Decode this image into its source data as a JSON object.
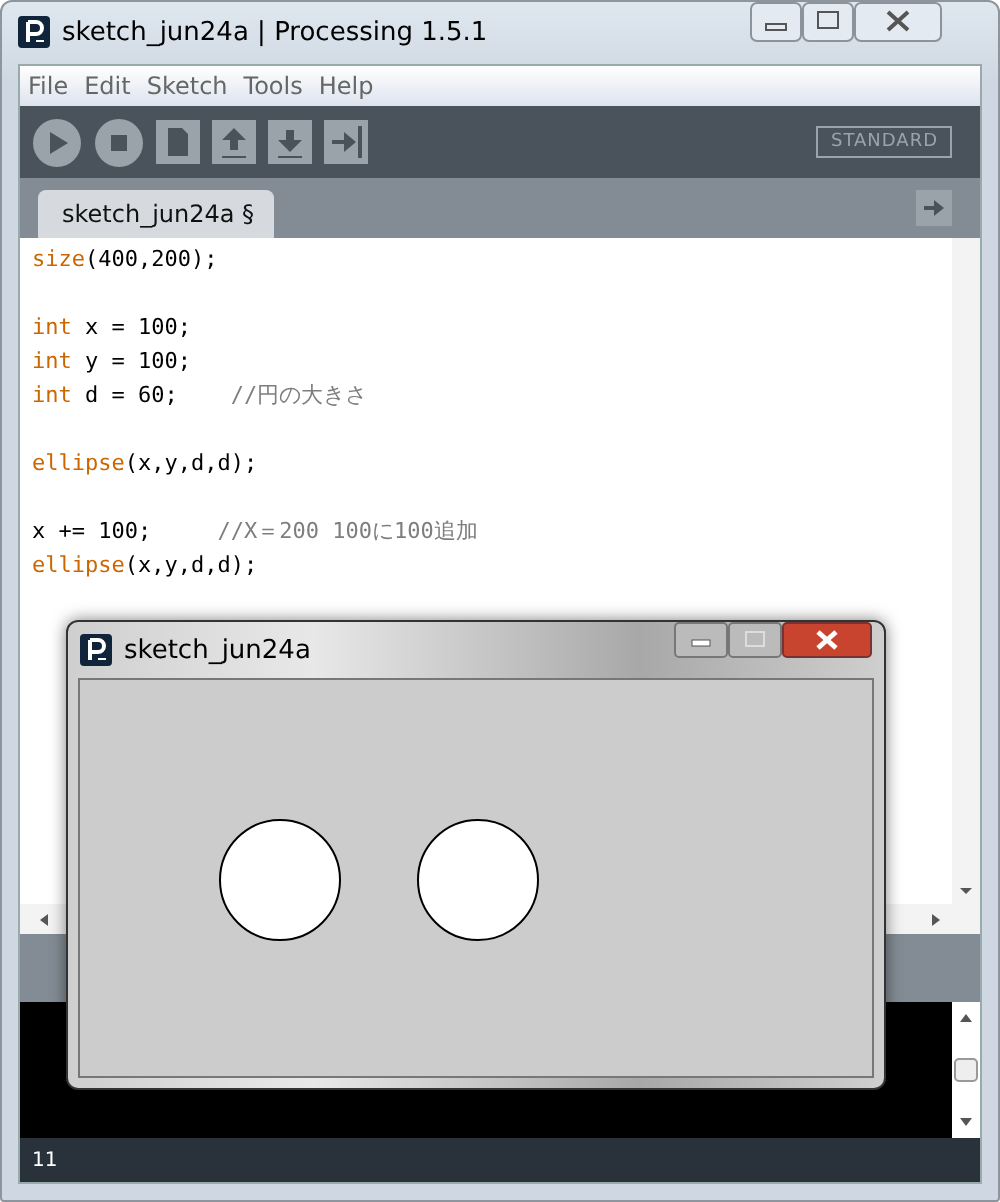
{
  "window": {
    "title": "sketch_jun24a | Processing 1.5.1"
  },
  "menu": [
    "File",
    "Edit",
    "Sketch",
    "Tools",
    "Help"
  ],
  "toolbar": {
    "mode": "STANDARD"
  },
  "tabs": [
    {
      "label": "sketch_jun24a §",
      "selected": true
    }
  ],
  "editor": {
    "lines": [
      {
        "kind": "code",
        "segments": [
          {
            "kind": "keyword",
            "text": "size"
          },
          {
            "kind": "plain",
            "text": "(400,200);"
          }
        ]
      },
      {
        "kind": "blank"
      },
      {
        "kind": "code",
        "segments": [
          {
            "kind": "keyword",
            "text": "int"
          },
          {
            "kind": "plain",
            "text": " x = 100;"
          }
        ]
      },
      {
        "kind": "code",
        "segments": [
          {
            "kind": "keyword",
            "text": "int"
          },
          {
            "kind": "plain",
            "text": " y = 100;"
          }
        ]
      },
      {
        "kind": "code",
        "segments": [
          {
            "kind": "keyword",
            "text": "int"
          },
          {
            "kind": "plain",
            "text": " d = 60;    "
          },
          {
            "kind": "comment",
            "text": "//円の大きさ"
          }
        ]
      },
      {
        "kind": "blank"
      },
      {
        "kind": "code",
        "segments": [
          {
            "kind": "keyword",
            "text": "ellipse"
          },
          {
            "kind": "plain",
            "text": "(x,y,d,d);"
          }
        ]
      },
      {
        "kind": "blank"
      },
      {
        "kind": "code",
        "segments": [
          {
            "kind": "plain",
            "text": "x += 100;     "
          },
          {
            "kind": "comment",
            "text": "//X＝200 100に100追加"
          }
        ]
      },
      {
        "kind": "code",
        "segments": [
          {
            "kind": "keyword",
            "text": "ellipse"
          },
          {
            "kind": "plain",
            "text": "(x,y,d,d);"
          }
        ]
      }
    ]
  },
  "status_bar": {
    "line": "11"
  },
  "sketch_window": {
    "title": "sketch_jun24a"
  }
}
